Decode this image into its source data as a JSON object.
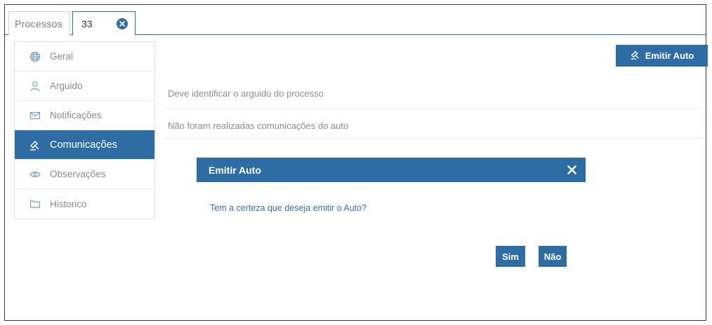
{
  "tabs": [
    {
      "label": "Processos"
    },
    {
      "label": "33"
    }
  ],
  "sidebar": {
    "items": [
      {
        "label": "Geral",
        "icon": "globe-icon"
      },
      {
        "label": "Arguido",
        "icon": "user-icon"
      },
      {
        "label": "Notificações",
        "icon": "envelope-icon"
      },
      {
        "label": "Comunicações",
        "icon": "gavel-icon",
        "active": true
      },
      {
        "label": "Observações",
        "icon": "eye-icon"
      },
      {
        "label": "Historico",
        "icon": "folder-icon"
      }
    ]
  },
  "main": {
    "emitir_button_label": "Emitir Auto",
    "message_arguido": "Deve identificar o arguido do processo",
    "message_comunicacoes": "Não foram realizadas comunicações do auto"
  },
  "dialog": {
    "title": "Emitir Auto",
    "question": "Tem a certeza que deseja emitir o Auto?",
    "yes_label": "Sim",
    "no_label": "Não"
  },
  "colors": {
    "accent": "#2e6da4",
    "muted_text": "#8c8c8c",
    "frame_border": "#3a3a3a"
  }
}
